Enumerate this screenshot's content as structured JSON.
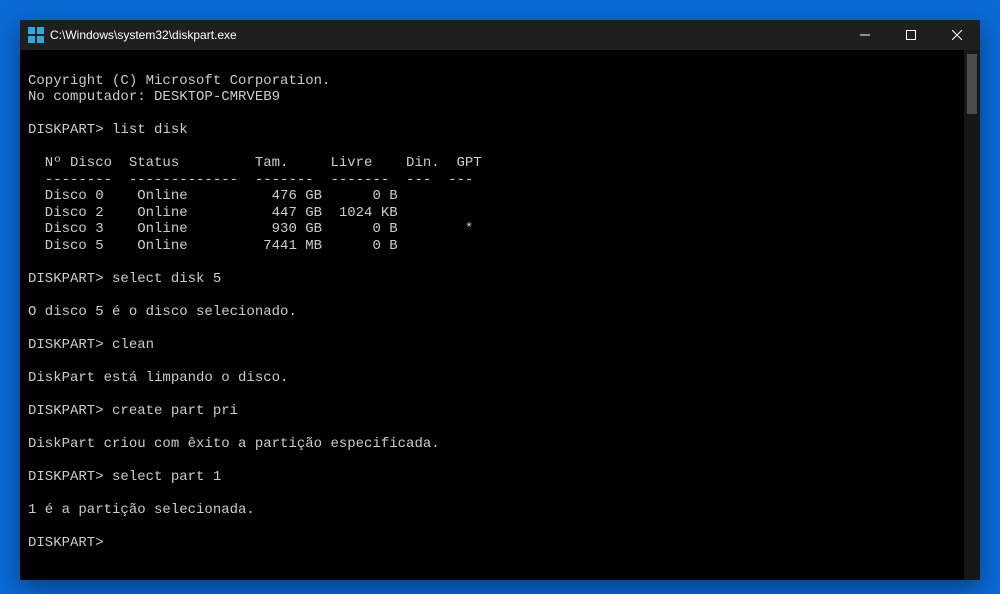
{
  "window": {
    "title": "C:\\Windows\\system32\\diskpart.exe"
  },
  "terminal": {
    "copyright": "Copyright (C) Microsoft Corporation.",
    "computer_line": "No computador: DESKTOP-CMRVEB9",
    "prompt": "DISKPART>",
    "cmd_list_disk": "list disk",
    "table_header": "  Nº Disco  Status         Tam.     Livre    Din.  GPT",
    "table_divider": "  --------  -------------  -------  -------  ---  ---",
    "disk_rows": [
      "  Disco 0    Online          476 GB      0 B",
      "  Disco 2    Online          447 GB  1024 KB",
      "  Disco 3    Online          930 GB      0 B        *",
      "  Disco 5    Online         7441 MB      0 B"
    ],
    "cmd_select_disk": "select disk 5",
    "msg_disk_selected": "O disco 5 é o disco selecionado.",
    "cmd_clean": "clean",
    "msg_cleaning": "DiskPart está limpando o disco.",
    "cmd_create_part": "create part pri",
    "msg_created": "DiskPart criou com êxito a partição especificada.",
    "cmd_select_part": "select part 1",
    "msg_part_selected": "1 é a partição selecionada."
  }
}
